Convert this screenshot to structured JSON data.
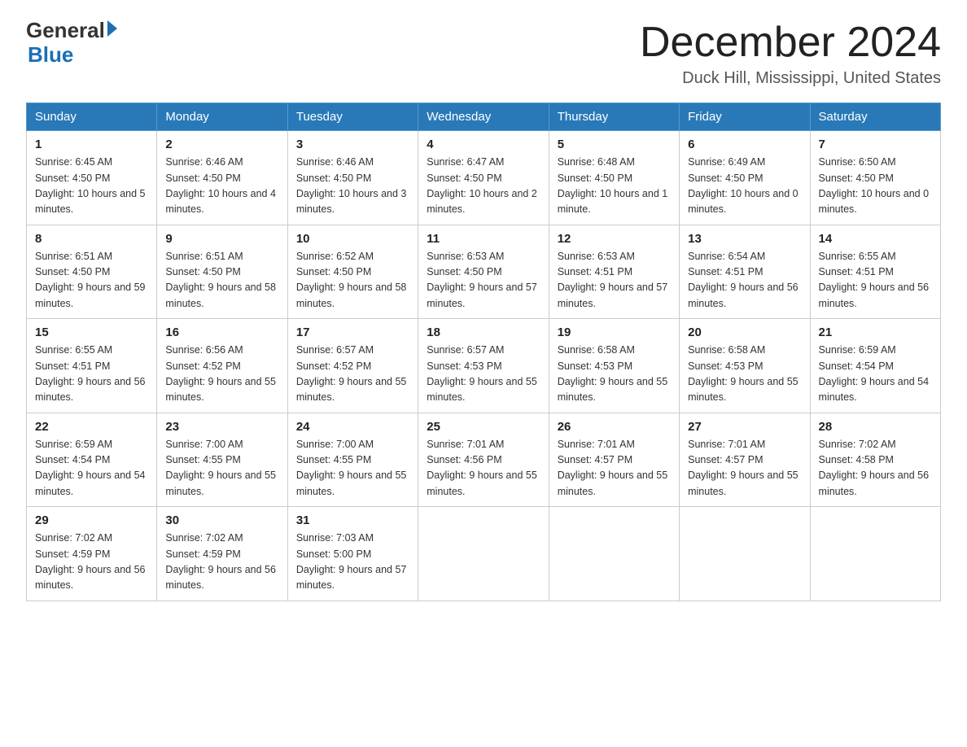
{
  "header": {
    "logo_general": "General",
    "logo_blue": "Blue",
    "month_title": "December 2024",
    "location": "Duck Hill, Mississippi, United States"
  },
  "weekdays": [
    "Sunday",
    "Monday",
    "Tuesday",
    "Wednesday",
    "Thursday",
    "Friday",
    "Saturday"
  ],
  "weeks": [
    [
      {
        "day": "1",
        "sunrise": "6:45 AM",
        "sunset": "4:50 PM",
        "daylight": "10 hours and 5 minutes."
      },
      {
        "day": "2",
        "sunrise": "6:46 AM",
        "sunset": "4:50 PM",
        "daylight": "10 hours and 4 minutes."
      },
      {
        "day": "3",
        "sunrise": "6:46 AM",
        "sunset": "4:50 PM",
        "daylight": "10 hours and 3 minutes."
      },
      {
        "day": "4",
        "sunrise": "6:47 AM",
        "sunset": "4:50 PM",
        "daylight": "10 hours and 2 minutes."
      },
      {
        "day": "5",
        "sunrise": "6:48 AM",
        "sunset": "4:50 PM",
        "daylight": "10 hours and 1 minute."
      },
      {
        "day": "6",
        "sunrise": "6:49 AM",
        "sunset": "4:50 PM",
        "daylight": "10 hours and 0 minutes."
      },
      {
        "day": "7",
        "sunrise": "6:50 AM",
        "sunset": "4:50 PM",
        "daylight": "10 hours and 0 minutes."
      }
    ],
    [
      {
        "day": "8",
        "sunrise": "6:51 AM",
        "sunset": "4:50 PM",
        "daylight": "9 hours and 59 minutes."
      },
      {
        "day": "9",
        "sunrise": "6:51 AM",
        "sunset": "4:50 PM",
        "daylight": "9 hours and 58 minutes."
      },
      {
        "day": "10",
        "sunrise": "6:52 AM",
        "sunset": "4:50 PM",
        "daylight": "9 hours and 58 minutes."
      },
      {
        "day": "11",
        "sunrise": "6:53 AM",
        "sunset": "4:50 PM",
        "daylight": "9 hours and 57 minutes."
      },
      {
        "day": "12",
        "sunrise": "6:53 AM",
        "sunset": "4:51 PM",
        "daylight": "9 hours and 57 minutes."
      },
      {
        "day": "13",
        "sunrise": "6:54 AM",
        "sunset": "4:51 PM",
        "daylight": "9 hours and 56 minutes."
      },
      {
        "day": "14",
        "sunrise": "6:55 AM",
        "sunset": "4:51 PM",
        "daylight": "9 hours and 56 minutes."
      }
    ],
    [
      {
        "day": "15",
        "sunrise": "6:55 AM",
        "sunset": "4:51 PM",
        "daylight": "9 hours and 56 minutes."
      },
      {
        "day": "16",
        "sunrise": "6:56 AM",
        "sunset": "4:52 PM",
        "daylight": "9 hours and 55 minutes."
      },
      {
        "day": "17",
        "sunrise": "6:57 AM",
        "sunset": "4:52 PM",
        "daylight": "9 hours and 55 minutes."
      },
      {
        "day": "18",
        "sunrise": "6:57 AM",
        "sunset": "4:53 PM",
        "daylight": "9 hours and 55 minutes."
      },
      {
        "day": "19",
        "sunrise": "6:58 AM",
        "sunset": "4:53 PM",
        "daylight": "9 hours and 55 minutes."
      },
      {
        "day": "20",
        "sunrise": "6:58 AM",
        "sunset": "4:53 PM",
        "daylight": "9 hours and 55 minutes."
      },
      {
        "day": "21",
        "sunrise": "6:59 AM",
        "sunset": "4:54 PM",
        "daylight": "9 hours and 54 minutes."
      }
    ],
    [
      {
        "day": "22",
        "sunrise": "6:59 AM",
        "sunset": "4:54 PM",
        "daylight": "9 hours and 54 minutes."
      },
      {
        "day": "23",
        "sunrise": "7:00 AM",
        "sunset": "4:55 PM",
        "daylight": "9 hours and 55 minutes."
      },
      {
        "day": "24",
        "sunrise": "7:00 AM",
        "sunset": "4:55 PM",
        "daylight": "9 hours and 55 minutes."
      },
      {
        "day": "25",
        "sunrise": "7:01 AM",
        "sunset": "4:56 PM",
        "daylight": "9 hours and 55 minutes."
      },
      {
        "day": "26",
        "sunrise": "7:01 AM",
        "sunset": "4:57 PM",
        "daylight": "9 hours and 55 minutes."
      },
      {
        "day": "27",
        "sunrise": "7:01 AM",
        "sunset": "4:57 PM",
        "daylight": "9 hours and 55 minutes."
      },
      {
        "day": "28",
        "sunrise": "7:02 AM",
        "sunset": "4:58 PM",
        "daylight": "9 hours and 56 minutes."
      }
    ],
    [
      {
        "day": "29",
        "sunrise": "7:02 AM",
        "sunset": "4:59 PM",
        "daylight": "9 hours and 56 minutes."
      },
      {
        "day": "30",
        "sunrise": "7:02 AM",
        "sunset": "4:59 PM",
        "daylight": "9 hours and 56 minutes."
      },
      {
        "day": "31",
        "sunrise": "7:03 AM",
        "sunset": "5:00 PM",
        "daylight": "9 hours and 57 minutes."
      },
      null,
      null,
      null,
      null
    ]
  ]
}
